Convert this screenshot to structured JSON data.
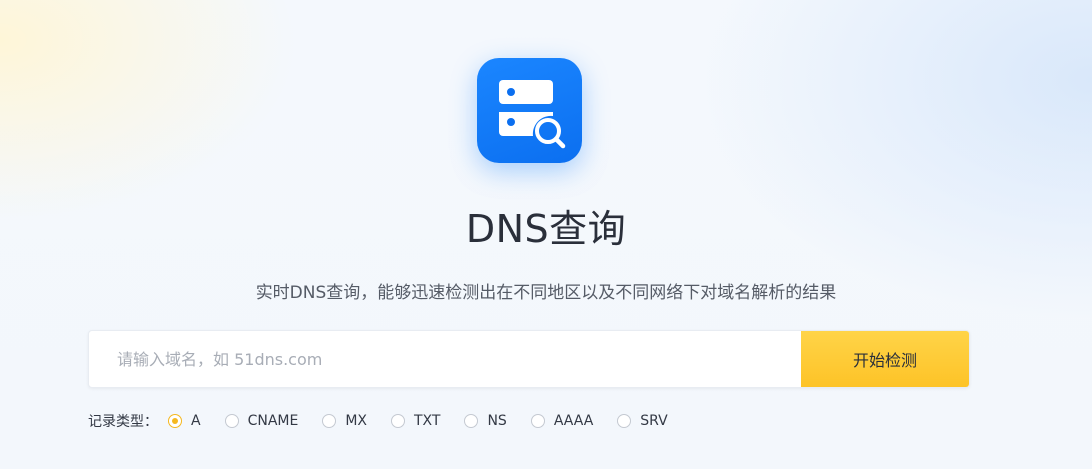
{
  "header": {
    "icon": "dns-server-search-icon",
    "title": "DNS查询",
    "subtitle": "实时DNS查询，能够迅速检测出在不同地区以及不同网络下对域名解析的结果"
  },
  "search": {
    "value": "",
    "placeholder": "请输入域名，如 51dns.com",
    "button_label": "开始检测"
  },
  "record_types": {
    "label": "记录类型：",
    "selected": "A",
    "options": [
      {
        "label": "A"
      },
      {
        "label": "CNAME"
      },
      {
        "label": "MX"
      },
      {
        "label": "TXT"
      },
      {
        "label": "NS"
      },
      {
        "label": "AAAA"
      },
      {
        "label": "SRV"
      }
    ]
  },
  "colors": {
    "accent_blue": "#0b6ff0",
    "button_yellow": "#fdc327",
    "radio_selected": "#f5b81f"
  }
}
